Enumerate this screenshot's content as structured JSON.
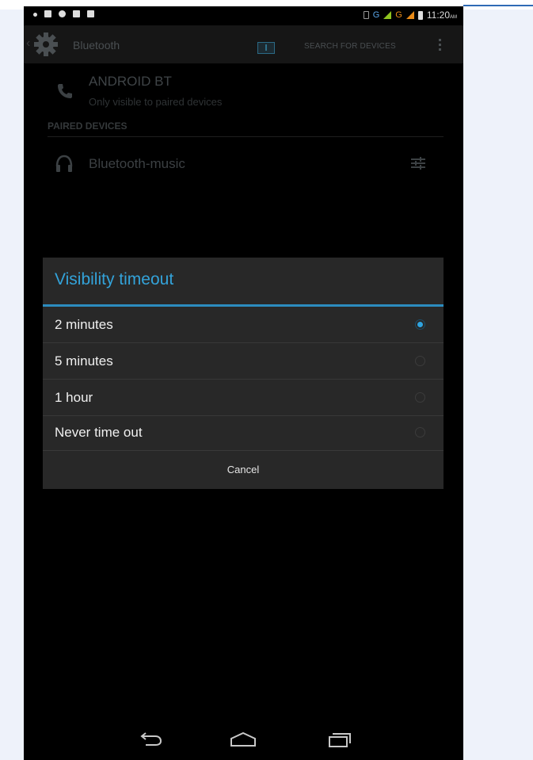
{
  "status_bar": {
    "network_label": "G",
    "time": "11:20",
    "ampm": "AM",
    "signal_colors": [
      "#8fc31f",
      "#e88a17"
    ]
  },
  "action_bar": {
    "title": "Bluetooth",
    "search_label": "SEARCH FOR DEVICES",
    "menu_icon": "overflow-menu-icon",
    "settings_icon": "gear-icon",
    "toggle_state": "on"
  },
  "bluetooth": {
    "device_name": "ANDROID BT",
    "device_subtitle": "Only visible to paired devices",
    "paired_header": "PAIRED DEVICES",
    "paired_devices": [
      {
        "name": "Bluetooth-music",
        "icon": "headphones-icon",
        "action_icon": "settings-sliders-icon"
      }
    ]
  },
  "dialog": {
    "title": "Visibility timeout",
    "options": [
      {
        "label": "2 minutes",
        "selected": true
      },
      {
        "label": "5 minutes",
        "selected": false
      },
      {
        "label": "1 hour",
        "selected": false
      },
      {
        "label": "Never time out",
        "selected": false
      }
    ],
    "cancel_label": "Cancel",
    "accent_color": "#33a3da"
  },
  "nav_bar": {
    "buttons": [
      "back-icon",
      "home-icon",
      "recent-apps-icon"
    ]
  }
}
